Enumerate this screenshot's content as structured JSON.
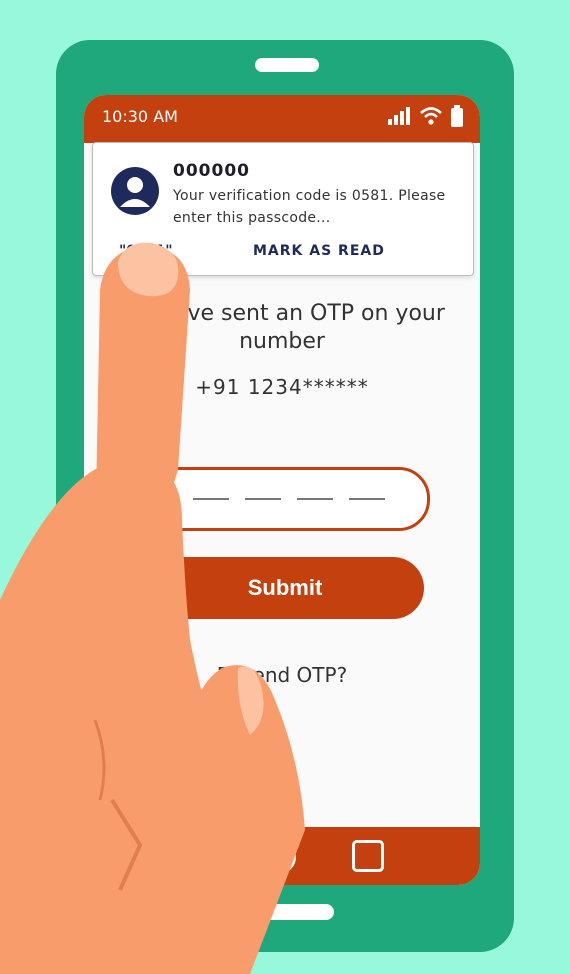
{
  "status_bar": {
    "time": "10:30 AM"
  },
  "notification": {
    "sender": "000000",
    "body": "Your verification code is 0581. Please enter this passcode...",
    "copy_code_action": "\"0581\"",
    "mark_read_action": "MARK AS READ"
  },
  "otp_screen": {
    "title": "We have sent an OTP on your number",
    "phone_number": "+91 1234******",
    "otp_digits": [
      "",
      "",
      "",
      ""
    ],
    "submit_label": "Submit",
    "resend_label": "Resend OTP?"
  },
  "colors": {
    "background": "#98f8dc",
    "phone_body": "#1ea87c",
    "accent": "#c4400f",
    "skin": "#f99c6c",
    "notification_text": "#1f2a5c"
  },
  "icons": [
    "signal-icon",
    "wifi-icon",
    "battery-icon",
    "user-avatar-icon",
    "home-nav-icon",
    "recent-apps-icon"
  ]
}
